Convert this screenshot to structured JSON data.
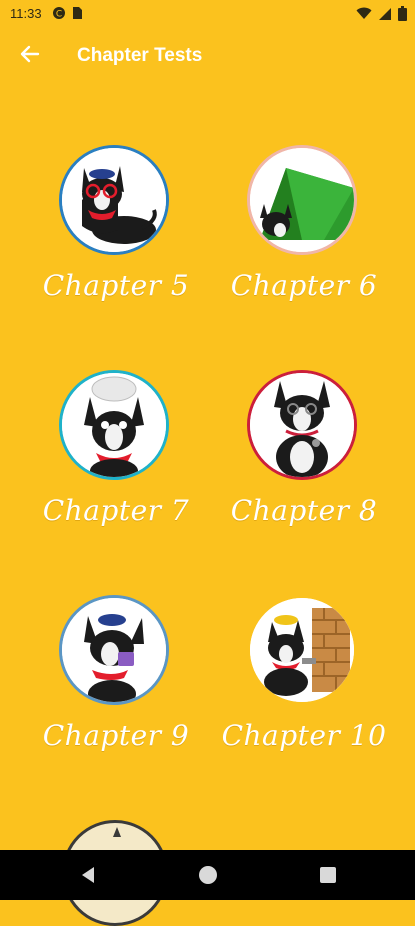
{
  "status_bar": {
    "time": "11:33"
  },
  "app_bar": {
    "title": "Chapter Tests",
    "back_icon": "arrow-left-icon"
  },
  "chapters": [
    {
      "label": "Chapter 5",
      "ring": "#2a7fc1"
    },
    {
      "label": "Chapter 6",
      "ring": "#f0b6a8"
    },
    {
      "label": "Chapter 7",
      "ring": "#1fb2c9"
    },
    {
      "label": "Chapter 8",
      "ring": "#cc1f3b"
    },
    {
      "label": "Chapter 9",
      "ring": "#5b96c4"
    },
    {
      "label": "Chapter 10",
      "ring": "#fbc21e"
    }
  ],
  "colors": {
    "background": "#FBC21E",
    "title_text": "#ffffff",
    "nav_bar": "#000000"
  }
}
